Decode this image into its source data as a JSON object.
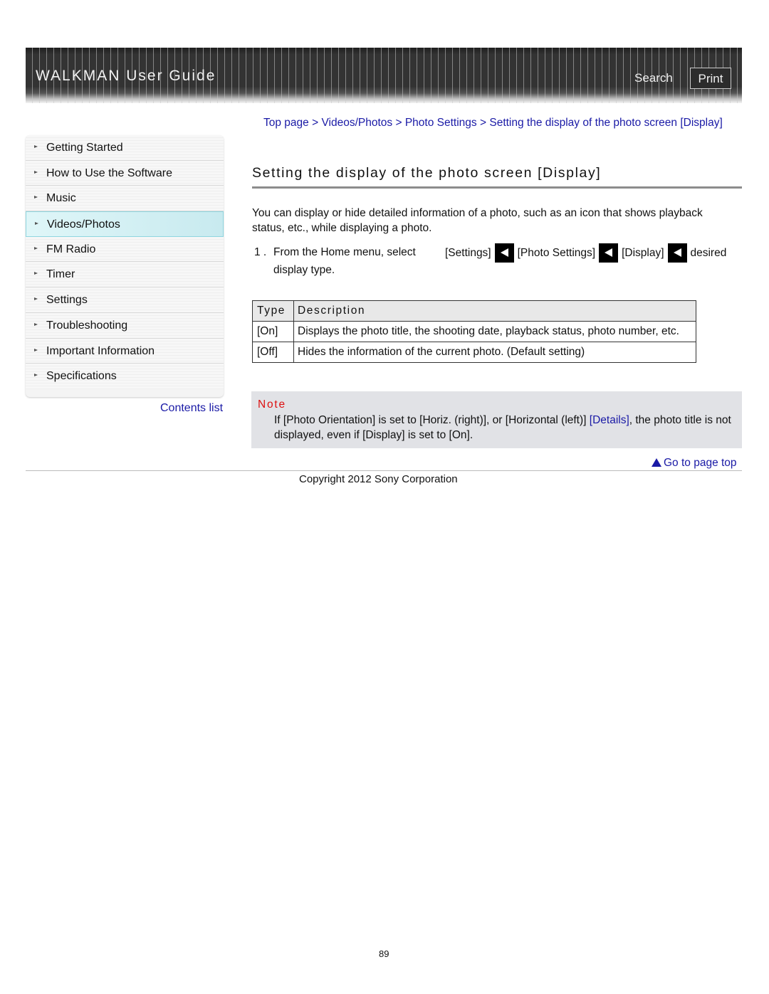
{
  "header": {
    "title": "WALKMAN User Guide",
    "search_label": "Search",
    "print_label": "Print"
  },
  "sidebar": {
    "items": [
      {
        "label": "Getting Started",
        "active": false
      },
      {
        "label": "How to Use the Software",
        "active": false
      },
      {
        "label": "Music",
        "active": false
      },
      {
        "label": "Videos/Photos",
        "active": true
      },
      {
        "label": "FM Radio",
        "active": false
      },
      {
        "label": "Timer",
        "active": false
      },
      {
        "label": "Settings",
        "active": false
      },
      {
        "label": "Troubleshooting",
        "active": false
      },
      {
        "label": "Important Information",
        "active": false
      },
      {
        "label": "Specifications",
        "active": false
      }
    ],
    "contents_link": "Contents list"
  },
  "breadcrumb": {
    "items": [
      "Top page",
      "Videos/Photos",
      "Photo Settings",
      "Setting the display of the photo screen [Display]"
    ],
    "separator": ">"
  },
  "main": {
    "title": "Setting the display of the photo screen [Display]",
    "intro": "You can display or hide detailed information of a photo, such as an icon that shows playback status, etc., while displaying a photo.",
    "step": {
      "number": "1 .",
      "text": "From the Home menu, select",
      "path": [
        "[Settings]",
        "[Photo Settings]",
        "[Display]",
        "desired"
      ],
      "continuation": "display type.",
      "path_icon": "arrow-left-icon"
    },
    "table": {
      "headers": [
        "Type",
        "Description"
      ],
      "rows": [
        [
          "[On]",
          "Displays the photo title, the shooting date, playback status, photo number, etc."
        ],
        [
          "[Off]",
          "Hides the information of the current photo. (Default setting)"
        ]
      ]
    },
    "note": {
      "title": "Note",
      "text_before": "If [Photo Orientation] is set to [Horiz. (right)], or [Horizontal (left)] ",
      "link": "[Details]",
      "text_after": ", the photo title is not displayed, even if [Display] is set to [On]."
    }
  },
  "footer": {
    "go_top": "Go to page top",
    "copyright": "Copyright 2012 Sony Corporation",
    "page_number": "89"
  },
  "colors": {
    "link": "#1a1aa6",
    "note_title": "#dd1111",
    "note_bg": "#e1e2e6",
    "active_item_bg": "#d4f0f4"
  }
}
